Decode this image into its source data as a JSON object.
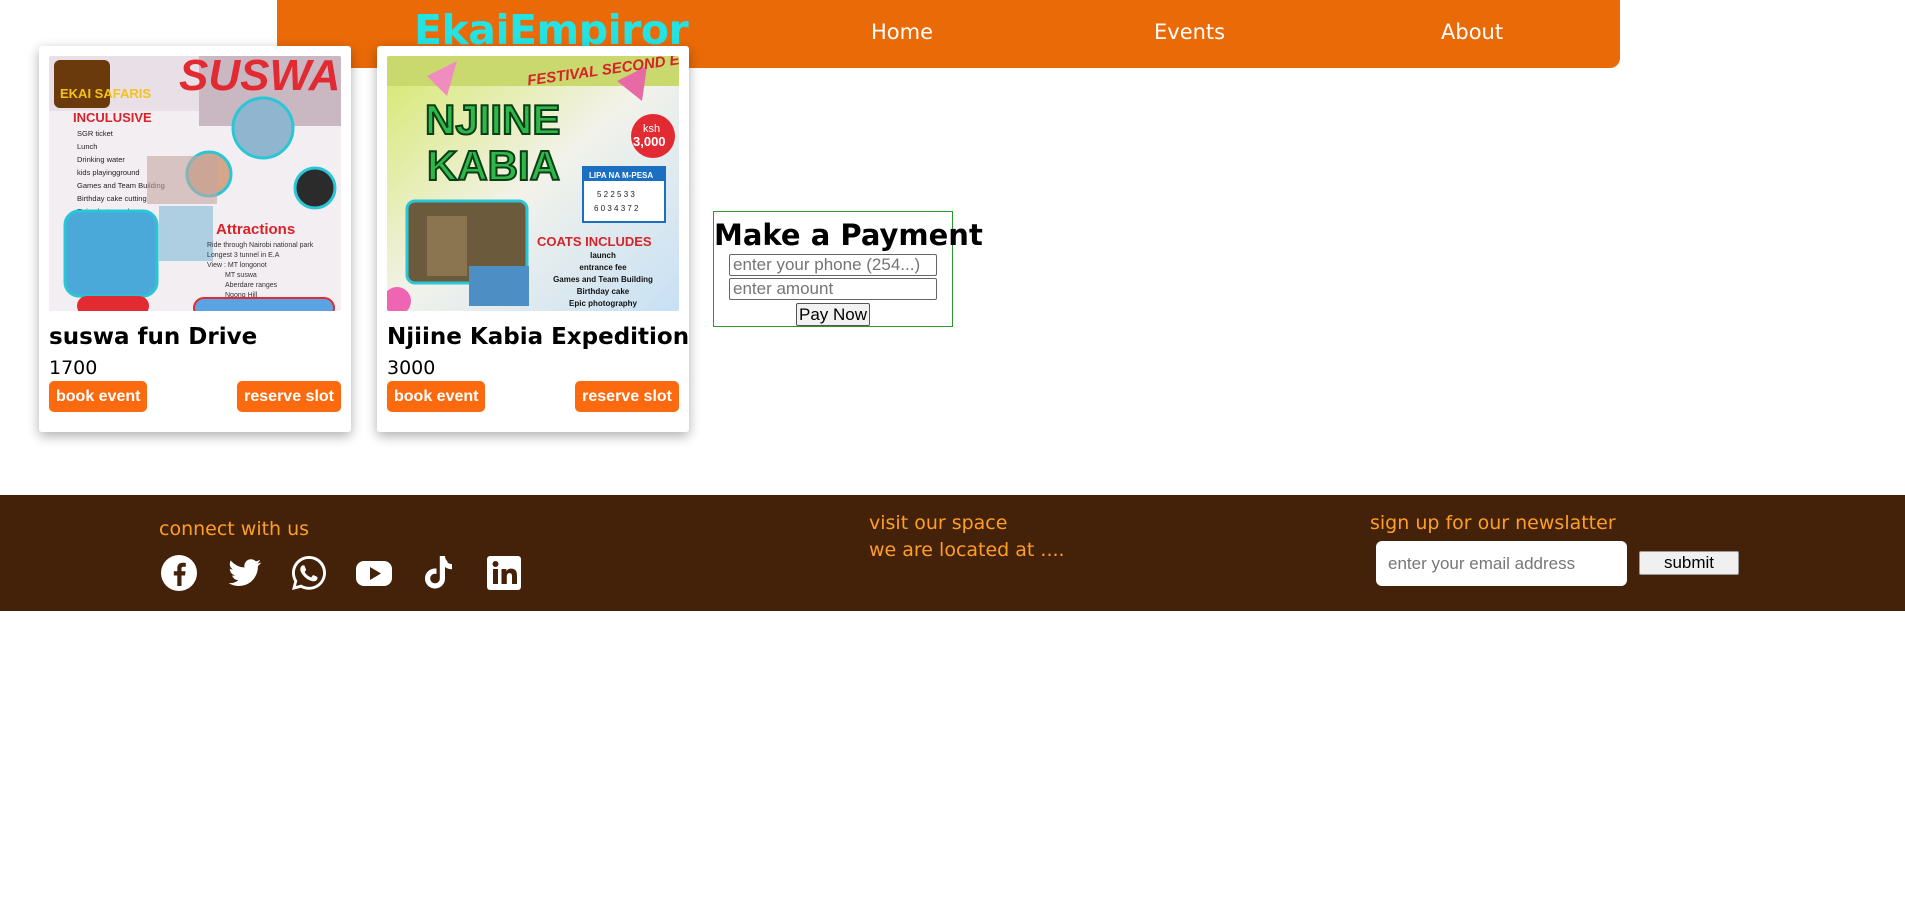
{
  "nav": {
    "brand": "EkaiEmpiror",
    "links": [
      "Home",
      "Events",
      "About"
    ],
    "bg_color": "#ea6a08",
    "brand_color": "#24e3e3"
  },
  "events": [
    {
      "title": "suswa fun Drive",
      "price": "1700",
      "book_label": "book event",
      "reserve_label": "reserve slot",
      "poster": {
        "logo": "EKAI SAFARIS",
        "headline": "SUSWA",
        "inclusive_title": "INCULUSIVE",
        "inclusive_items": [
          "SGR ticket",
          "Lunch",
          "Drinking water",
          "kids playingground",
          "Games and Team Building",
          "Birthday cake cutting",
          "Epic photography"
        ],
        "attractions_title": "Attractions",
        "attractions_items": [
          "Ride through Nairobi national park",
          "Longest 3 tunnel in E.A",
          "View : MT longonot",
          "MT suswa",
          "Aberdare ranges",
          "Ngong Hill"
        ]
      }
    },
    {
      "title": "Njiine Kabia Expedition",
      "price": "3000",
      "book_label": "book event",
      "reserve_label": "reserve slot",
      "poster": {
        "edition": "FESTIVAL SECOND EDITION",
        "headline_1": "NJIINE",
        "headline_2": "KABIA",
        "price_badge_1": "ksh",
        "price_badge_2": "3,000",
        "mpesa_title": "LIPA NA M-PESA",
        "mpesa_line_1": "5 2 2 5 3 3",
        "mpesa_line_2": "6 0 3 4 3 7 2",
        "includes_title": "COATS INCLUDES",
        "includes_items": [
          "launch",
          "entrance fee",
          "Games and Team Building",
          "Birthday cake",
          "Epic photography"
        ]
      }
    }
  ],
  "payment": {
    "title": "Make a Payment",
    "phone_placeholder": "enter your phone (254...)",
    "amount_placeholder": "enter amount",
    "pay_label": "Pay Now"
  },
  "footer": {
    "connect_label": "connect with us",
    "social_icons": [
      "facebook-icon",
      "twitter-icon",
      "whatsapp-icon",
      "youtube-icon",
      "tiktok-icon",
      "linkedin-icon"
    ],
    "visit_label": "visit our space",
    "location_label": "we are located at ....",
    "newsletter_label": "sign up for our newslatter",
    "email_placeholder": "enter your email address",
    "submit_label": "submit",
    "bg_color": "#44220a",
    "text_color": "#ff9e25"
  }
}
